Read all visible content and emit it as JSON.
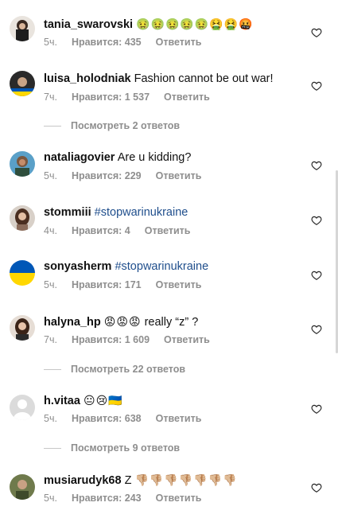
{
  "comments": [
    {
      "username": "tania_swarovski",
      "text": "",
      "emoji": "🤢🤢🤢🤢🤢🤮🤮🤬",
      "time": "5ч.",
      "likes": "Нравится: 435",
      "reply": "Ответить"
    },
    {
      "username": "luisa_holodniak",
      "text": "Fashion cannot be out war!",
      "emoji": "",
      "time": "7ч.",
      "likes": "Нравится: 1 537",
      "reply": "Ответить",
      "view_replies": "Посмотреть 2 ответов"
    },
    {
      "username": "nataliagovier",
      "text": "Are u kidding?",
      "emoji": "",
      "time": "5ч.",
      "likes": "Нравится: 229",
      "reply": "Ответить"
    },
    {
      "username": "stommiii",
      "text": "#stopwarinukraine",
      "emoji": "",
      "time": "4ч.",
      "likes": "Нравится: 4",
      "reply": "Ответить"
    },
    {
      "username": "sonyasherm",
      "text": "#stopwarinukraine",
      "emoji": "",
      "time": "5ч.",
      "likes": "Нравится: 171",
      "reply": "Ответить"
    },
    {
      "username": "halyna_hp",
      "text": "really “z” ?",
      "emoji": "😡😡😡",
      "time": "7ч.",
      "likes": "Нравится: 1 609",
      "reply": "Ответить",
      "view_replies": "Посмотреть 22 ответов"
    },
    {
      "username": "h.vitaa",
      "text": "",
      "emoji": "😐😢🇺🇦",
      "time": "5ч.",
      "likes": "Нравится: 638",
      "reply": "Ответить",
      "view_replies": "Посмотреть 9 ответов"
    },
    {
      "username": "musiarudyk68",
      "text": "Z",
      "emoji": "👎🏼👎🏼👎🏼👎🏼👎🏼👎🏼👎🏼",
      "time": "5ч.",
      "likes": "Нравится: 243",
      "reply": "Ответить"
    }
  ],
  "colors": {
    "hashtag": "#1f4e8c",
    "meta": "#8e8e8e",
    "ukraine_blue": "#0057b7",
    "ukraine_yellow": "#ffd700"
  }
}
